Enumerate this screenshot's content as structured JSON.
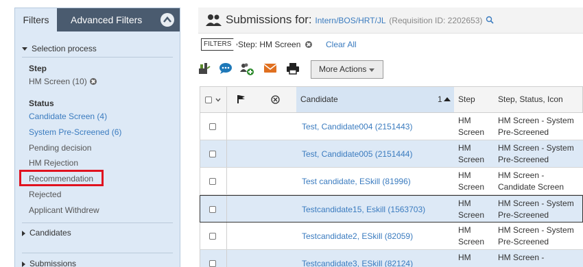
{
  "sidebar": {
    "tab_filters": "Filters",
    "tab_advanced": "Advanced Filters",
    "selection_process": "Selection process",
    "step_heading": "Step",
    "step_value": "HM Screen (10)",
    "status_heading": "Status",
    "status_items": [
      "Candidate Screen (4)",
      "System Pre-Screened (6)",
      "Pending decision",
      "HM Rejection",
      "Recommendation",
      "Rejected",
      "Applicant Withdrew"
    ],
    "candidates_section": "Candidates",
    "submissions_section": "Submissions"
  },
  "header": {
    "title": "Submissions for:",
    "requisition_name": "Intern/BOS/HRT/JL",
    "requisition_id": "(Requisition ID: 2202653)"
  },
  "filters_bar": {
    "badge": "FILTERS",
    "active_filter": "Step: HM Screen",
    "clear_all": "Clear All"
  },
  "toolbar": {
    "more_actions": "More Actions"
  },
  "grid": {
    "columns": {
      "candidate": "Candidate",
      "sort_index": "1",
      "step": "Step",
      "step_status_icon": "Step, Status, Icon"
    },
    "rows": [
      {
        "candidate": "Test, Candidate004 (2151443)",
        "step": "HM\nScreen",
        "ssi": "HM Screen - System\nPre-Screened"
      },
      {
        "candidate": "Test, Candidate005 (2151444)",
        "step": "HM\nScreen",
        "ssi": "HM Screen - System\nPre-Screened"
      },
      {
        "candidate": "Test candidate, ESkill (81996)",
        "step": "HM\nScreen",
        "ssi": "HM Screen -\nCandidate Screen"
      },
      {
        "candidate": "Testcandidate15, Eskill (1563703)",
        "step": "HM\nScreen",
        "ssi": "HM Screen - System\nPre-Screened"
      },
      {
        "candidate": "Testcandidate2, ESkill (82059)",
        "step": "HM\nScreen",
        "ssi": "HM Screen - System\nPre-Screened"
      },
      {
        "candidate": "Testcandidate3, ESkill (82124)",
        "step": "HM",
        "ssi": "HM Screen -"
      }
    ]
  },
  "colors": {
    "accent_link": "#3a7bbf",
    "sidebar_bg": "#dde9f6",
    "tab_dark": "#4a5b6f",
    "highlight_red": "#e0121f"
  }
}
